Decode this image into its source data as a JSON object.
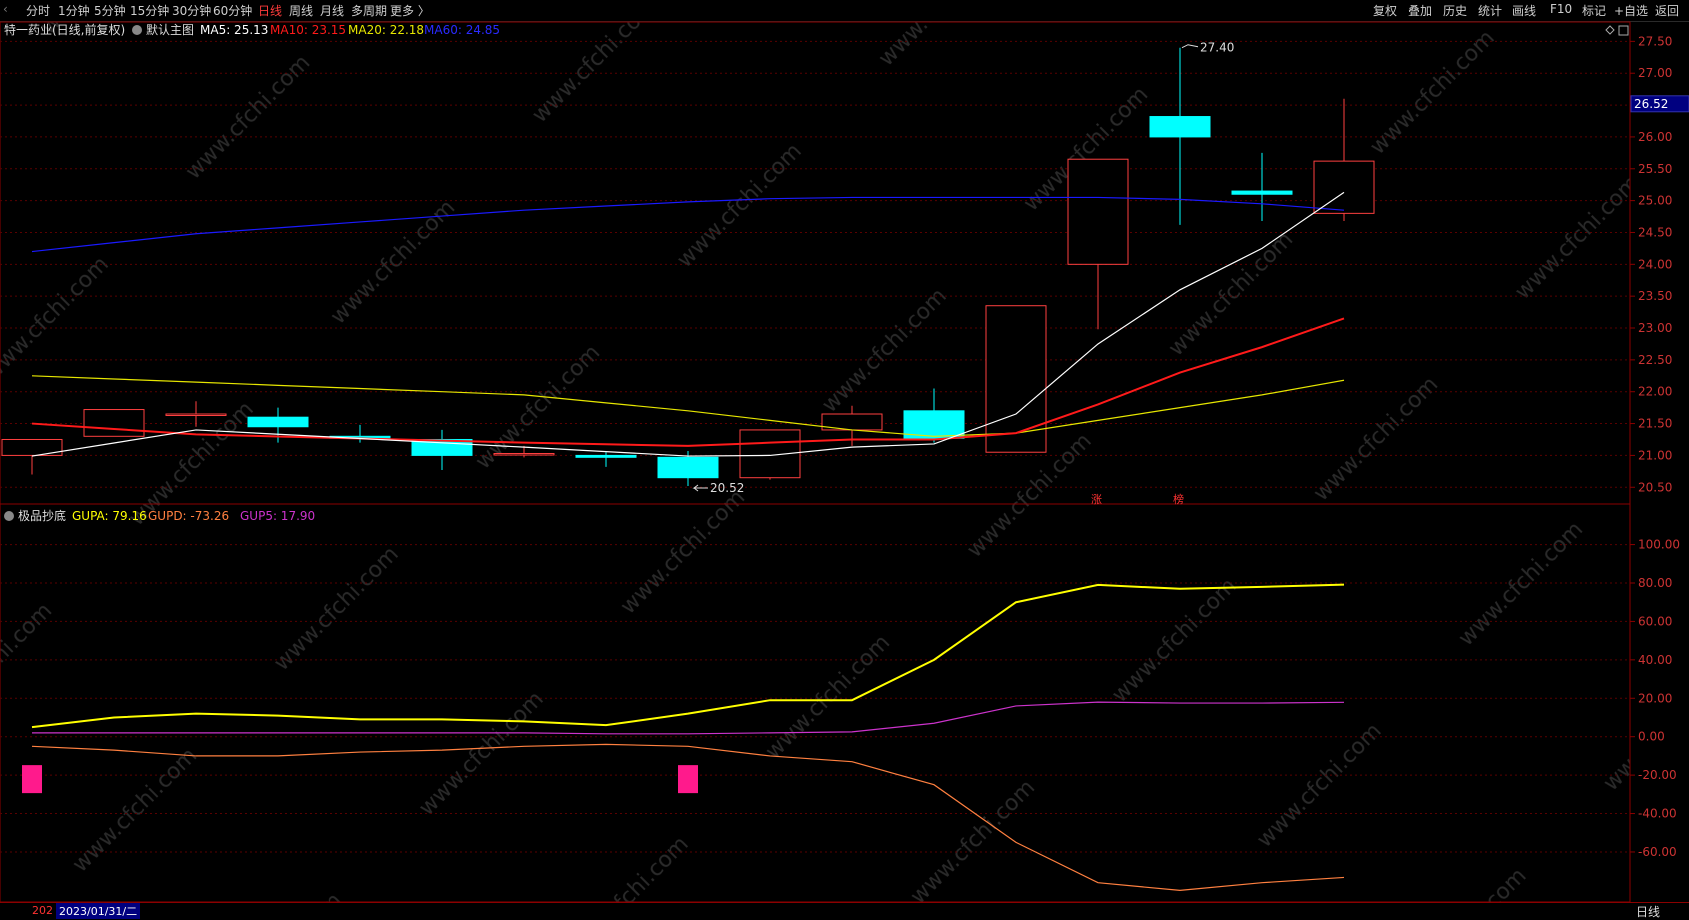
{
  "toolbar": {
    "periods": [
      "分时",
      "1分钟",
      "5分钟",
      "15分钟",
      "30分钟",
      "60分钟",
      "日线",
      "周线",
      "月线",
      "多周期",
      "更多 〉"
    ],
    "active_period": "日线",
    "right": [
      "复权",
      "叠加",
      "历史",
      "统计",
      "画线",
      "F10",
      "标记",
      "+自选",
      "返回"
    ]
  },
  "main_header": {
    "stock": "特一药业(日线,前复权)",
    "indicator": "默认主图",
    "ma5": "MA5: 25.13",
    "ma10": "MA10: 23.15",
    "ma20": "MA20: 22.18",
    "ma60": "MA60: 24.85"
  },
  "sub_header": {
    "name": "极品抄底",
    "gupa": "GUPA: 79.16",
    "gupd": "GUPD: -73.26",
    "gup5": "GUP5: 17.90"
  },
  "annotations": {
    "high": "27.40",
    "low": "20.52",
    "tag1": "涨",
    "tag2": "榜"
  },
  "watermark": "www.cfchi.com",
  "current_price": "26.52",
  "footer": {
    "date": "2023/01/31/二",
    "year_hint": "202",
    "period": "日线"
  },
  "colors": {
    "up": "#ff4040",
    "down": "#00ffff",
    "ma5": "#ffffff",
    "ma10": "#ff1a1a",
    "ma20": "#e6e600",
    "ma60": "#1a1aff",
    "gupa": "#ffff00",
    "gupd": "#ff8040",
    "gup5": "#cc33cc",
    "marker": "#ff1a8c"
  },
  "chart_data": [
    {
      "type": "candlestick",
      "ylim": [
        20.3,
        27.6
      ],
      "yticks": [
        "27.50",
        "27.00",
        "26.50",
        "26.00",
        "25.50",
        "25.00",
        "24.50",
        "24.00",
        "23.50",
        "23.00",
        "22.50",
        "22.00",
        "21.50",
        "21.00",
        "20.50"
      ],
      "candles": [
        {
          "o": 21.0,
          "h": 21.25,
          "l": 20.7,
          "c": 21.25
        },
        {
          "o": 21.3,
          "h": 21.72,
          "l": 21.3,
          "c": 21.72
        },
        {
          "o": 21.65,
          "h": 21.85,
          "l": 21.45,
          "c": 21.65
        },
        {
          "o": 21.6,
          "h": 21.75,
          "l": 21.2,
          "c": 21.45
        },
        {
          "o": 21.3,
          "h": 21.48,
          "l": 21.2,
          "c": 21.27
        },
        {
          "o": 21.25,
          "h": 21.4,
          "l": 20.77,
          "c": 21.0
        },
        {
          "o": 21.03,
          "h": 21.15,
          "l": 20.97,
          "c": 21.03
        },
        {
          "o": 21.0,
          "h": 21.05,
          "l": 20.82,
          "c": 20.97
        },
        {
          "o": 20.97,
          "h": 21.07,
          "l": 20.52,
          "c": 20.65
        },
        {
          "o": 20.65,
          "h": 21.4,
          "l": 20.62,
          "c": 21.4
        },
        {
          "o": 21.4,
          "h": 21.78,
          "l": 21.15,
          "c": 21.65
        },
        {
          "o": 21.7,
          "h": 22.05,
          "l": 21.2,
          "c": 21.27
        },
        {
          "o": 21.05,
          "h": 23.35,
          "l": 21.05,
          "c": 23.35
        },
        {
          "o": 24.0,
          "h": 25.65,
          "l": 22.98,
          "c": 25.65
        },
        {
          "o": 26.32,
          "h": 27.4,
          "l": 24.62,
          "c": 26.0
        },
        {
          "o": 25.15,
          "h": 25.75,
          "l": 24.68,
          "c": 25.1
        },
        {
          "o": 24.8,
          "h": 26.6,
          "l": 24.68,
          "c": 25.62
        }
      ],
      "ma5": [
        20.99,
        null,
        21.4,
        null,
        null,
        null,
        21.13,
        null,
        20.99,
        21.0,
        21.13,
        21.18,
        21.65,
        22.75,
        23.6,
        24.25,
        25.13
      ],
      "ma10": [
        21.5,
        null,
        21.33,
        null,
        null,
        null,
        21.2,
        null,
        21.15,
        21.2,
        21.25,
        21.25,
        21.35,
        21.8,
        22.3,
        22.7,
        23.15
      ],
      "ma20": [
        22.25,
        null,
        22.15,
        null,
        null,
        null,
        21.95,
        null,
        21.7,
        21.55,
        21.4,
        21.3,
        21.35,
        21.55,
        21.75,
        21.95,
        22.18
      ],
      "ma60": [
        24.2,
        null,
        24.48,
        null,
        null,
        null,
        24.85,
        null,
        24.98,
        25.03,
        25.05,
        25.05,
        25.05,
        25.05,
        25.02,
        24.95,
        24.85
      ]
    },
    {
      "type": "line",
      "ylim": [
        -85,
        118
      ],
      "yticks": [
        "100.00",
        "80.00",
        "60.00",
        "40.00",
        "20.00",
        "0.00",
        "-20.00",
        "-40.00",
        "-60.00"
      ],
      "series": [
        {
          "name": "GUPA",
          "values": [
            5,
            10,
            12,
            11,
            9,
            9,
            8,
            6,
            12,
            19,
            19,
            40,
            70,
            79,
            77,
            78,
            79.16
          ]
        },
        {
          "name": "GUPD",
          "values": [
            -5,
            -7,
            -10,
            -10,
            -8,
            -7,
            -5,
            -4,
            -5,
            -10,
            -13,
            -25,
            -55,
            -76,
            -80,
            -76,
            -73.26
          ]
        },
        {
          "name": "GUP5",
          "values": [
            2,
            2,
            2,
            2,
            2,
            2,
            2,
            1.5,
            1.5,
            2,
            2.5,
            7,
            16,
            18,
            17.5,
            17.5,
            17.9
          ]
        }
      ],
      "markers": [
        0,
        8
      ]
    }
  ]
}
